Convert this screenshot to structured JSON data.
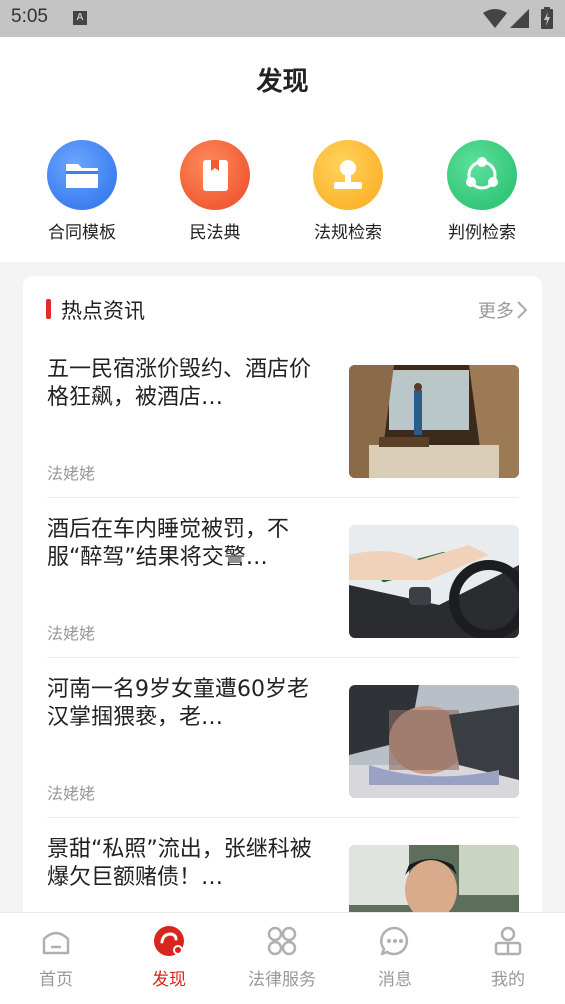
{
  "status_bar": {
    "time": "5:05",
    "notification_badge": "A"
  },
  "header": {
    "title": "发现"
  },
  "quick_actions": [
    {
      "label": "合同模板",
      "icon": "folder-icon",
      "color": "#3e7ff0"
    },
    {
      "label": "民法典",
      "icon": "book-icon",
      "color": "#f25c35"
    },
    {
      "label": "法规检索",
      "icon": "stamp-icon",
      "color": "#fcb52f"
    },
    {
      "label": "判例检索",
      "icon": "share-icon",
      "color": "#33c77a"
    }
  ],
  "hot_news": {
    "title": "热点资讯",
    "more_label": "更多",
    "items": [
      {
        "title": "五一民宿涨价毁约、酒店价格狂飙，被酒店…",
        "source": "法姥姥"
      },
      {
        "title": "酒后在车内睡觉被罚，不服“醉驾”结果将交警…",
        "source": "法姥姥"
      },
      {
        "title": "河南一名9岁女童遭60岁老汉掌掴猥亵，老…",
        "source": "法姥姥"
      },
      {
        "title": "景甜“私照”流出，张继科被爆欠巨额赌债！…",
        "source": "法姥姥"
      }
    ]
  },
  "tab_bar": {
    "active": "发现",
    "accent_color": "#d9261c",
    "tabs": [
      {
        "label": "首页",
        "icon": "home-icon"
      },
      {
        "label": "发现",
        "icon": "discover-icon"
      },
      {
        "label": "法律服务",
        "icon": "services-icon"
      },
      {
        "label": "消息",
        "icon": "message-icon"
      },
      {
        "label": "我的",
        "icon": "profile-icon"
      }
    ]
  }
}
